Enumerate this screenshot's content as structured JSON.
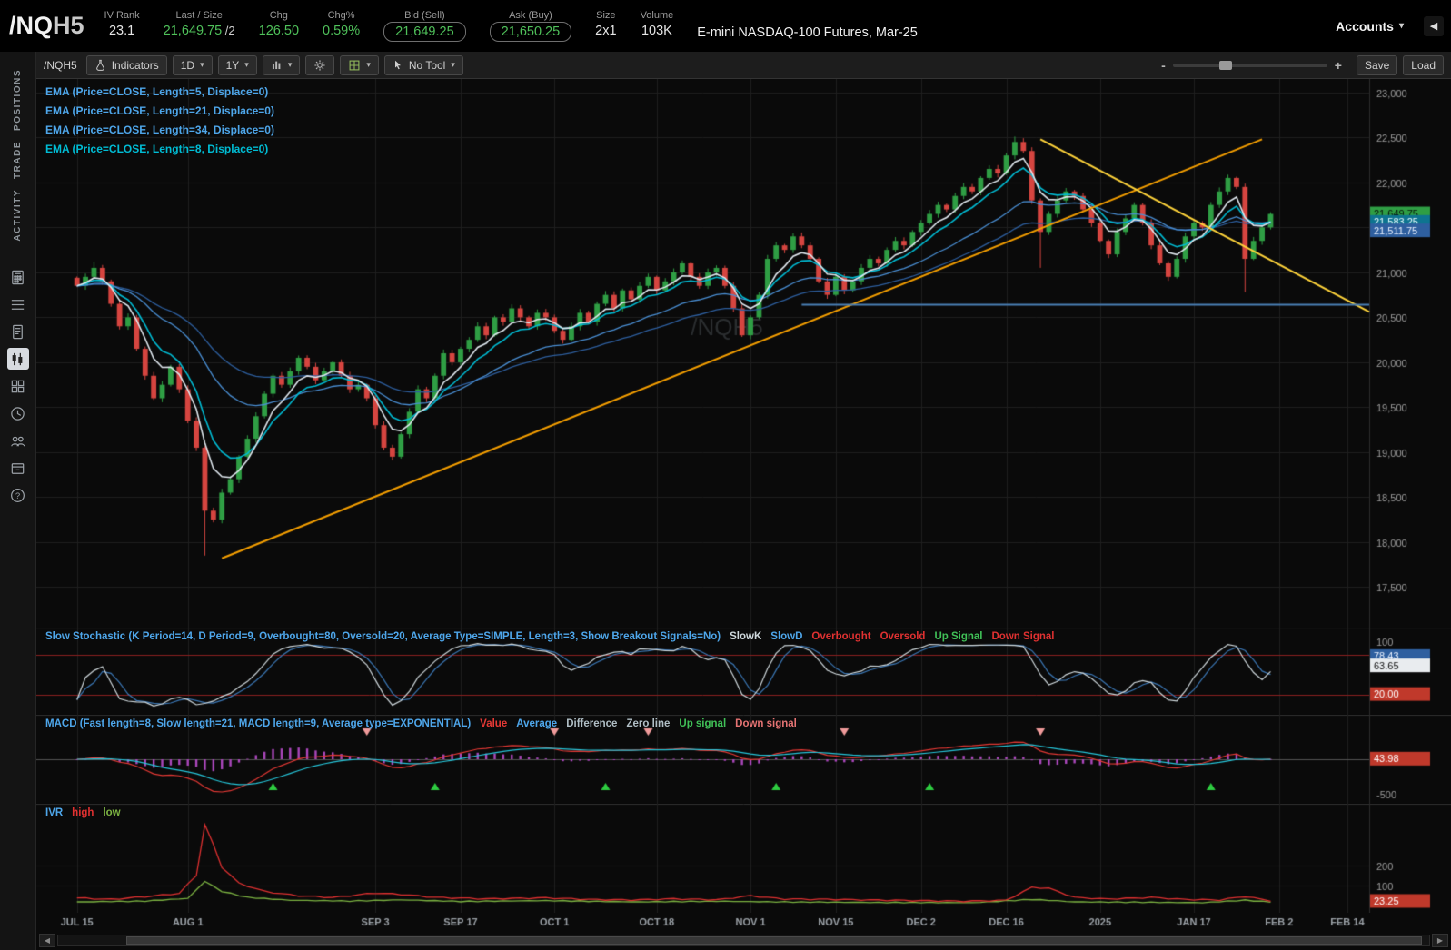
{
  "icons": {
    "chevron_down": "▾",
    "triangle_left": "◀",
    "triangle_right": "▶"
  },
  "header": {
    "symbol": "/NQ",
    "symbol_suffix": "H5",
    "instrument": "E-mini NASDAQ-100 Futures, Mar-25",
    "accounts_label": "Accounts",
    "fields": [
      {
        "key": "iv-rank",
        "label": "IV Rank",
        "value": "23.1",
        "color": "white"
      },
      {
        "key": "last-size",
        "label": "Last / Size",
        "value": "21,649.75",
        "suffix": " /2",
        "color": "green"
      },
      {
        "key": "chg",
        "label": "Chg",
        "value": "126.50",
        "color": "green"
      },
      {
        "key": "chg-pct",
        "label": "Chg%",
        "value": "0.59%",
        "color": "green"
      },
      {
        "key": "bid",
        "label": "Bid (Sell)",
        "value": "21,649.25",
        "color": "green",
        "boxed": true
      },
      {
        "key": "ask",
        "label": "Ask (Buy)",
        "value": "21,650.25",
        "color": "green",
        "boxed": true
      },
      {
        "key": "size",
        "label": "Size",
        "value": "2x1",
        "color": "white"
      },
      {
        "key": "volume",
        "label": "Volume",
        "value": "103K",
        "color": "white"
      }
    ]
  },
  "sidebar": {
    "tabs": [
      "POSITIONS",
      "TRADE",
      "ACTIVITY"
    ],
    "icons": [
      {
        "name": "calculator-icon"
      },
      {
        "name": "watchlist-icon"
      },
      {
        "name": "orders-icon"
      },
      {
        "name": "chart-icon",
        "active": true
      },
      {
        "name": "grid-apps-icon"
      },
      {
        "name": "history-icon"
      },
      {
        "name": "community-icon"
      },
      {
        "name": "archive-icon"
      },
      {
        "name": "help-icon"
      }
    ]
  },
  "toolbar": {
    "symbol": "/NQH5",
    "indicators": "Indicators",
    "aggregation": "1D",
    "range": "1Y",
    "no_tool": "No Tool",
    "save": "Save",
    "load": "Load",
    "zoom_out": "-",
    "zoom_in": "+"
  },
  "chart_data": {
    "type": "candlestick",
    "watermark": "/NQH5",
    "last_price": "21,649.75",
    "ylim": [
      17050,
      23150
    ],
    "yticks": [
      23000,
      22500,
      22000,
      21500,
      21000,
      20500,
      20000,
      19500,
      19000,
      18500,
      18000,
      17500
    ],
    "up_color": "#2f9e44",
    "down_color": "#d64540",
    "closes": [
      20850,
      20950,
      21050,
      20900,
      20650,
      20400,
      20500,
      20150,
      19850,
      19600,
      19750,
      19950,
      19700,
      19350,
      19050,
      18350,
      18250,
      18550,
      18700,
      18950,
      19150,
      19400,
      19650,
      19850,
      19750,
      19900,
      20050,
      19950,
      19800,
      19900,
      20000,
      19850,
      19700,
      19750,
      19600,
      19300,
      19050,
      18950,
      19200,
      19450,
      19700,
      19600,
      19850,
      20100,
      20000,
      20150,
      20250,
      20400,
      20300,
      20500,
      20450,
      20600,
      20500,
      20400,
      20550,
      20500,
      20350,
      20250,
      20400,
      20550,
      20450,
      20650,
      20750,
      20600,
      20800,
      20700,
      20850,
      20950,
      20800,
      20900,
      21000,
      21100,
      20950,
      20850,
      21000,
      21050,
      20850,
      20600,
      20300,
      20500,
      20750,
      21150,
      21300,
      21250,
      21400,
      21300,
      21150,
      20900,
      20750,
      20950,
      20800,
      20900,
      21050,
      21150,
      21100,
      21250,
      21350,
      21300,
      21450,
      21550,
      21650,
      21750,
      21700,
      21850,
      21950,
      21900,
      22050,
      22150,
      22100,
      22300,
      22450,
      22350,
      21800,
      21450,
      21650,
      21800,
      21900,
      21850,
      21700,
      21550,
      21350,
      21200,
      21450,
      21600,
      21750,
      21550,
      21300,
      21100,
      20950,
      21150,
      21400,
      21550,
      21500,
      21750,
      21900,
      22050,
      21950,
      21150,
      21350,
      21500,
      21649.75
    ],
    "wick_lows": {
      "15": 17850,
      "113": 21050,
      "137": 20780
    },
    "wick_highs": {
      "2": 21120,
      "110": 22510
    },
    "emas": [
      {
        "label": "EMA (Price=CLOSE, Length=5, Displace=0)",
        "length": 5,
        "line_color": "#dfe7ee",
        "legend_color": "#4ea6ea"
      },
      {
        "label": "EMA (Price=CLOSE, Length=21, Displace=0)",
        "length": 21,
        "line_color": "#4a8fd4",
        "legend_color": "#4ea6ea"
      },
      {
        "label": "EMA (Price=CLOSE, Length=34, Displace=0)",
        "length": 34,
        "line_color": "#2e5f9f",
        "legend_color": "#4ea6ea"
      },
      {
        "label": "EMA (Price=CLOSE, Length=8, Displace=0)",
        "length": 8,
        "line_color": "#00bcd4",
        "legend_color": "#00bcd4"
      }
    ],
    "drawings": [
      {
        "type": "segment",
        "color": "#f59f00",
        "from_i": 17,
        "from_p": 17820,
        "to_i": 139,
        "to_p": 22480
      },
      {
        "type": "segment",
        "color": "#ffd43b",
        "from_i": 113,
        "from_p": 22480,
        "to_i": 152,
        "to_p": 20560
      },
      {
        "type": "segment",
        "color": "#4a7fb5",
        "from_i": 85,
        "from_p": 20640,
        "to_i": 152,
        "to_p": 20640
      }
    ],
    "axis_bubbles": [
      {
        "p": 21650,
        "text": "21,649.75",
        "bg": "#2f9e44",
        "fg": "#06130b"
      },
      {
        "p": 21556,
        "text": "21,583.25",
        "bg": "#0e7490",
        "fg": "#eafcff"
      },
      {
        "p": 21462,
        "text": "21,511.75",
        "bg": "#2e5f9f",
        "fg": "#eaf2ff"
      }
    ],
    "xlabels": [
      {
        "text": "JUL 15",
        "i": 0
      },
      {
        "text": "AUG 1",
        "i": 13
      },
      {
        "text": "SEP 3",
        "i": 35
      },
      {
        "text": "SEP 17",
        "i": 45
      },
      {
        "text": "OCT 1",
        "i": 56
      },
      {
        "text": "OCT 18",
        "i": 68
      },
      {
        "text": "NOV 1",
        "i": 79
      },
      {
        "text": "NOV 15",
        "i": 89
      },
      {
        "text": "DEC 2",
        "i": 99
      },
      {
        "text": "DEC 16",
        "i": 109
      },
      {
        "text": "2025",
        "i": 120
      },
      {
        "text": "JAN 17",
        "i": 131
      },
      {
        "text": "FEB 2",
        "i": 141
      },
      {
        "text": "FEB 14",
        "i": 149
      }
    ]
  },
  "stoch": {
    "title": "Slow Stochastic (K Period=14, D Period=9, Overbought=80, Oversold=20, Average Type=SIMPLE, Length=3, Show Breakout Signals=No)",
    "title_color": "#4ea6ea",
    "legend": [
      {
        "text": "SlowK",
        "color": "#cfd8dc"
      },
      {
        "text": "SlowD",
        "color": "#4ea6ea"
      },
      {
        "text": "Overbought",
        "color": "#e03131"
      },
      {
        "text": "Oversold",
        "color": "#e03131"
      },
      {
        "text": "Up Signal",
        "color": "#40c057"
      },
      {
        "text": "Down Signal",
        "color": "#e03131"
      }
    ],
    "overbought": 80,
    "oversold": 20,
    "axis_top": "100",
    "k_color": "#cfd8dc",
    "d_color": "#3b77b5",
    "band_color": "#8b2020",
    "bubbles": [
      {
        "v": 78,
        "text": "78.43",
        "bg": "#2e5f9f",
        "fg": "#eaf2ff"
      },
      {
        "v": 63.65,
        "text": "63.65",
        "bg": "#e9ecef",
        "fg": "#111111"
      },
      {
        "v": 20,
        "text": "20.00",
        "bg": "#c0392b",
        "fg": "#ffffff"
      }
    ]
  },
  "macd": {
    "title": "MACD (Fast length=8, Slow length=21, MACD length=9, Average type=EXPONENTIAL)",
    "title_color": "#4ea6ea",
    "legend": [
      {
        "text": "Value",
        "color": "#e53935"
      },
      {
        "text": "Average",
        "color": "#4ea6ea"
      },
      {
        "text": "Difference",
        "color": "#b0bec5"
      },
      {
        "text": "Zero line",
        "color": "#b0bec5"
      },
      {
        "text": "Up signal",
        "color": "#40c057"
      },
      {
        "text": "Down signal",
        "color": "#e57373"
      }
    ],
    "fast": 8,
    "slow": 21,
    "signal": 9,
    "value_color": "#e53935",
    "average_color": "#26c6da",
    "hist_color": "#ab47bc",
    "up_signals": [
      23,
      42,
      62,
      82,
      100,
      133
    ],
    "down_signals": [
      34,
      56,
      67,
      90,
      113
    ],
    "bubble": {
      "text": "43.98",
      "bg": "#c0392b",
      "fg": "#ffffff"
    },
    "axis_bottom": "-500"
  },
  "ivr": {
    "title": "IVR",
    "title_color": "#4ea6ea",
    "high_label": "high",
    "high_color": "#e03131",
    "low_label": "low",
    "low_color": "#7cb342",
    "yticks": [
      200,
      100
    ],
    "ylim": [
      0,
      450
    ],
    "bubble": {
      "text": "23.25",
      "bg": "#c0392b",
      "fg": "#ffffff"
    },
    "red_keys": [
      [
        0,
        38
      ],
      [
        4,
        30
      ],
      [
        8,
        44
      ],
      [
        12,
        60
      ],
      [
        14,
        150
      ],
      [
        15,
        400
      ],
      [
        16,
        300
      ],
      [
        17,
        190
      ],
      [
        19,
        110
      ],
      [
        22,
        70
      ],
      [
        26,
        48
      ],
      [
        30,
        40
      ],
      [
        35,
        62
      ],
      [
        38,
        55
      ],
      [
        42,
        40
      ],
      [
        48,
        33
      ],
      [
        55,
        38
      ],
      [
        60,
        30
      ],
      [
        65,
        27
      ],
      [
        70,
        33
      ],
      [
        75,
        28
      ],
      [
        79,
        48
      ],
      [
        83,
        32
      ],
      [
        89,
        30
      ],
      [
        95,
        26
      ],
      [
        99,
        24
      ],
      [
        104,
        21
      ],
      [
        109,
        26
      ],
      [
        112,
        90
      ],
      [
        114,
        85
      ],
      [
        117,
        40
      ],
      [
        121,
        32
      ],
      [
        126,
        40
      ],
      [
        130,
        30
      ],
      [
        134,
        27
      ],
      [
        137,
        45
      ],
      [
        140,
        23.25
      ]
    ],
    "green_keys": [
      [
        0,
        18
      ],
      [
        8,
        22
      ],
      [
        13,
        35
      ],
      [
        15,
        120
      ],
      [
        17,
        70
      ],
      [
        20,
        40
      ],
      [
        25,
        26
      ],
      [
        32,
        22
      ],
      [
        38,
        28
      ],
      [
        45,
        20
      ],
      [
        55,
        24
      ],
      [
        65,
        18
      ],
      [
        75,
        21
      ],
      [
        85,
        17
      ],
      [
        95,
        15
      ],
      [
        105,
        14
      ],
      [
        112,
        30
      ],
      [
        117,
        18
      ],
      [
        125,
        16
      ],
      [
        132,
        14
      ],
      [
        137,
        26
      ],
      [
        140,
        18
      ]
    ]
  },
  "scrollbar": {}
}
